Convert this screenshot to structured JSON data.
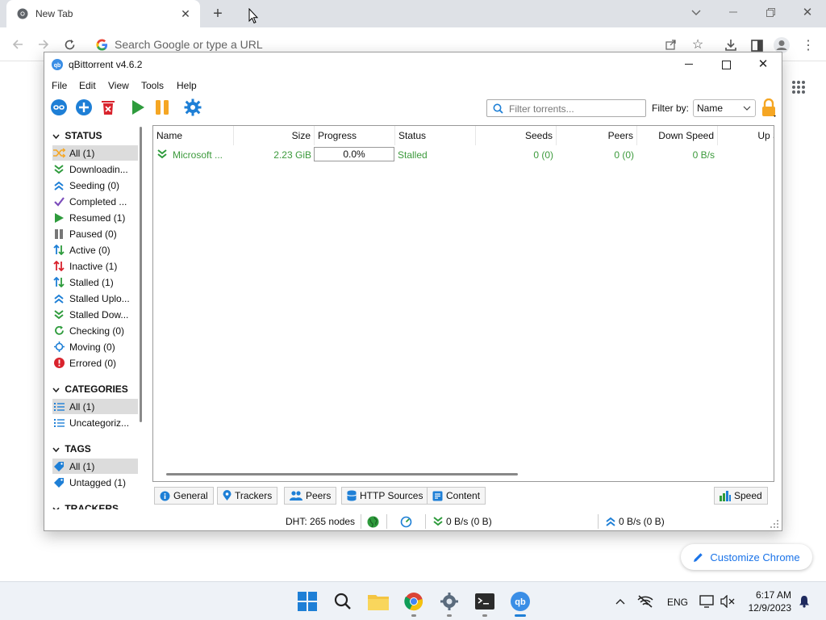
{
  "chrome": {
    "tab_title": "New Tab",
    "omnibox_placeholder": "Search Google or type a URL",
    "customize_label": "Customize Chrome"
  },
  "qb": {
    "title": "qBittorrent v4.6.2",
    "menu": [
      "File",
      "Edit",
      "View",
      "Tools",
      "Help"
    ],
    "filter_placeholder": "Filter torrents...",
    "filter_by_label": "Filter by:",
    "filter_by_value": "Name",
    "sidebar": {
      "status_header": "STATUS",
      "status_items": [
        {
          "label": "All (1)",
          "icon": "shuffle-icon"
        },
        {
          "label": "Downloadin...",
          "icon": "double-down-icon"
        },
        {
          "label": "Seeding (0)",
          "icon": "double-up-icon"
        },
        {
          "label": "Completed ...",
          "icon": "check-icon"
        },
        {
          "label": "Resumed (1)",
          "icon": "play-icon"
        },
        {
          "label": "Paused (0)",
          "icon": "pause-icon"
        },
        {
          "label": "Active (0)",
          "icon": "updown-arrows-icon"
        },
        {
          "label": "Inactive (1)",
          "icon": "updown-arrows-red-icon"
        },
        {
          "label": "Stalled (1)",
          "icon": "updown-arrows-icon"
        },
        {
          "label": "Stalled Uplo...",
          "icon": "double-up-icon"
        },
        {
          "label": "Stalled Dow...",
          "icon": "double-down-icon"
        },
        {
          "label": "Checking (0)",
          "icon": "refresh-icon"
        },
        {
          "label": "Moving (0)",
          "icon": "move-icon"
        },
        {
          "label": "Errored (0)",
          "icon": "error-icon"
        }
      ],
      "categories_header": "CATEGORIES",
      "category_items": [
        {
          "label": "All (1)",
          "icon": "list-icon"
        },
        {
          "label": "Uncategoriz...",
          "icon": "list-icon"
        }
      ],
      "tags_header": "TAGS",
      "tag_items": [
        {
          "label": "All (1)",
          "icon": "tag-icon"
        },
        {
          "label": "Untagged (1)",
          "icon": "tag-icon"
        }
      ],
      "trackers_header": "TRACKERS"
    },
    "columns": [
      "Name",
      "Size",
      "Progress",
      "Status",
      "Seeds",
      "Peers",
      "Down Speed",
      "Up S"
    ],
    "rows": [
      {
        "name": "Microsoft ...",
        "size": "2.23 GiB",
        "progress": "0.0%",
        "progress_fraction": 0.0,
        "status": "Stalled",
        "seeds": "0 (0)",
        "peers": "0 (0)",
        "down_speed": "0 B/s"
      }
    ],
    "bottom_tabs": [
      "General",
      "Trackers",
      "Peers",
      "HTTP Sources",
      "Content"
    ],
    "speed_tab": "Speed",
    "statusbar": {
      "dht": "DHT: 265 nodes",
      "down": "0 B/s (0 B)",
      "up": "0 B/s (0 B)"
    }
  },
  "taskbar": {
    "lang": "ENG",
    "time": "6:17 AM",
    "date": "12/9/2023"
  },
  "colors": {
    "green": "#2e9b3c",
    "blue": "#1e7fd6",
    "orange": "#f5a623",
    "red": "#d9232d"
  }
}
